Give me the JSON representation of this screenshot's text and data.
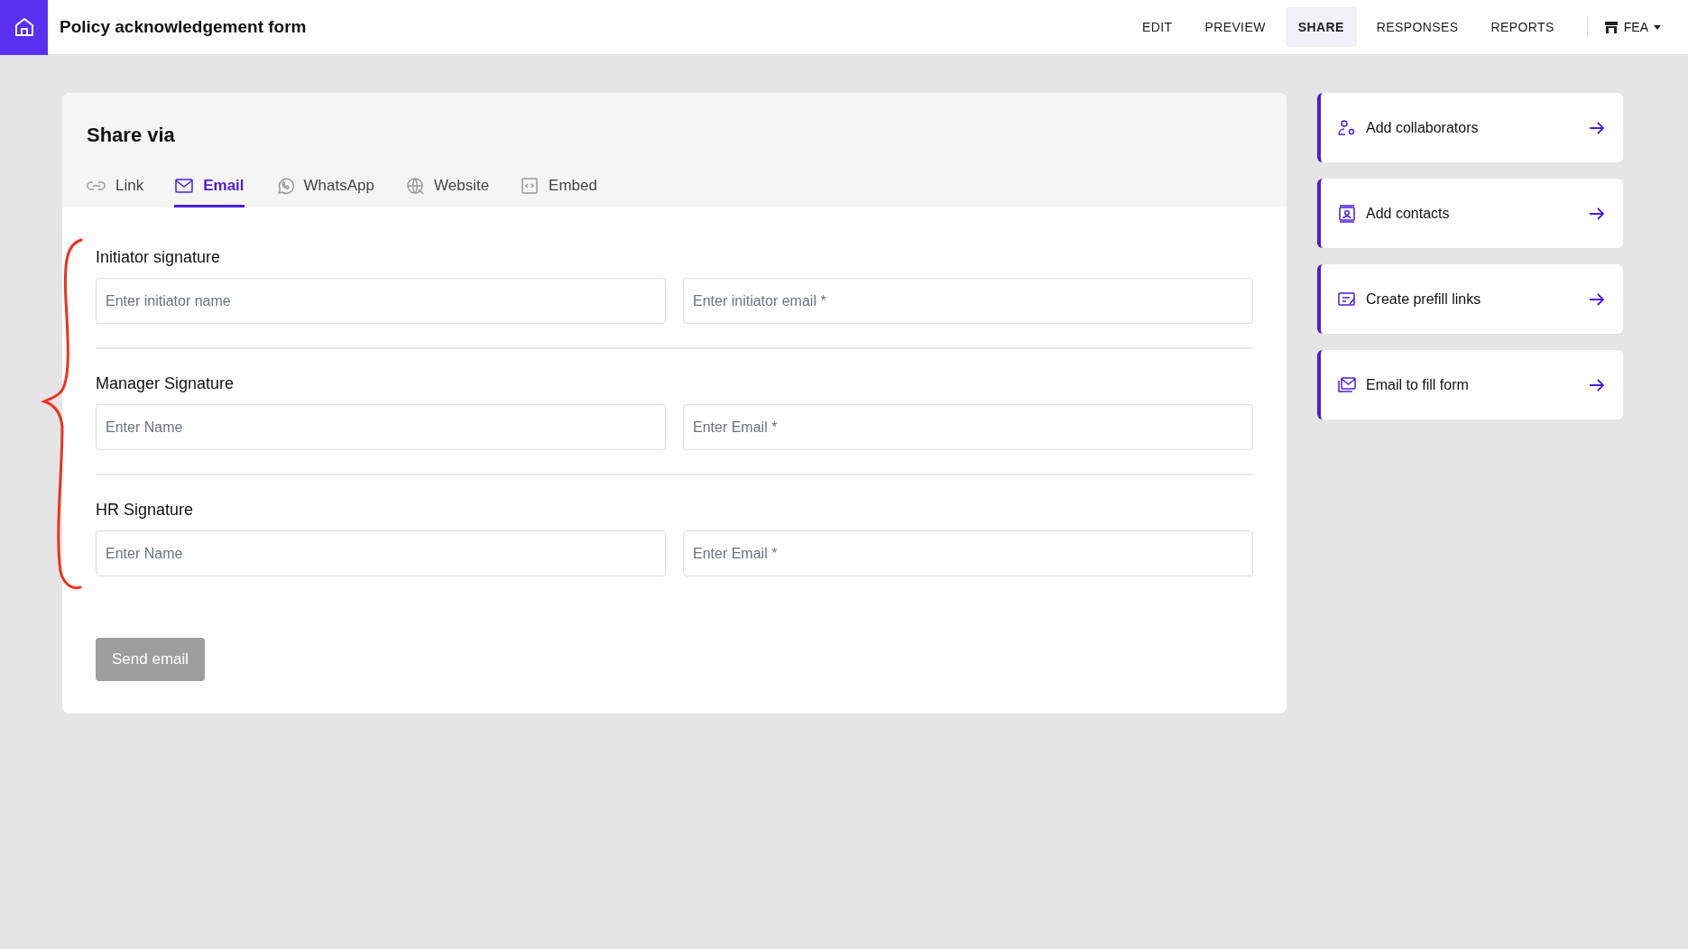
{
  "header": {
    "title": "Policy acknowledgement form",
    "nav": [
      {
        "label": "EDIT",
        "selected": false
      },
      {
        "label": "PREVIEW",
        "selected": false
      },
      {
        "label": "SHARE",
        "selected": true
      },
      {
        "label": "RESPONSES",
        "selected": false
      },
      {
        "label": "REPORTS",
        "selected": false
      }
    ],
    "workspace": "FEA"
  },
  "share": {
    "title": "Share via",
    "tabs": [
      {
        "label": "Link",
        "selected": false
      },
      {
        "label": "Email",
        "selected": true
      },
      {
        "label": "WhatsApp",
        "selected": false
      },
      {
        "label": "Website",
        "selected": false
      },
      {
        "label": "Embed",
        "selected": false
      }
    ],
    "sections": [
      {
        "label": "Initiator signature",
        "name_placeholder": "Enter initiator name",
        "email_placeholder": "Enter initiator email *"
      },
      {
        "label": "Manager Signature",
        "name_placeholder": "Enter Name",
        "email_placeholder": "Enter Email *"
      },
      {
        "label": "HR Signature",
        "name_placeholder": "Enter Name",
        "email_placeholder": "Enter Email *"
      }
    ],
    "send_button": {
      "label": "Send email",
      "disabled": true
    }
  },
  "actions": [
    {
      "label": "Add collaborators"
    },
    {
      "label": "Add contacts"
    },
    {
      "label": "Create prefill links"
    },
    {
      "label": "Email to fill form"
    }
  ],
  "annotation": {
    "kind": "brace"
  }
}
